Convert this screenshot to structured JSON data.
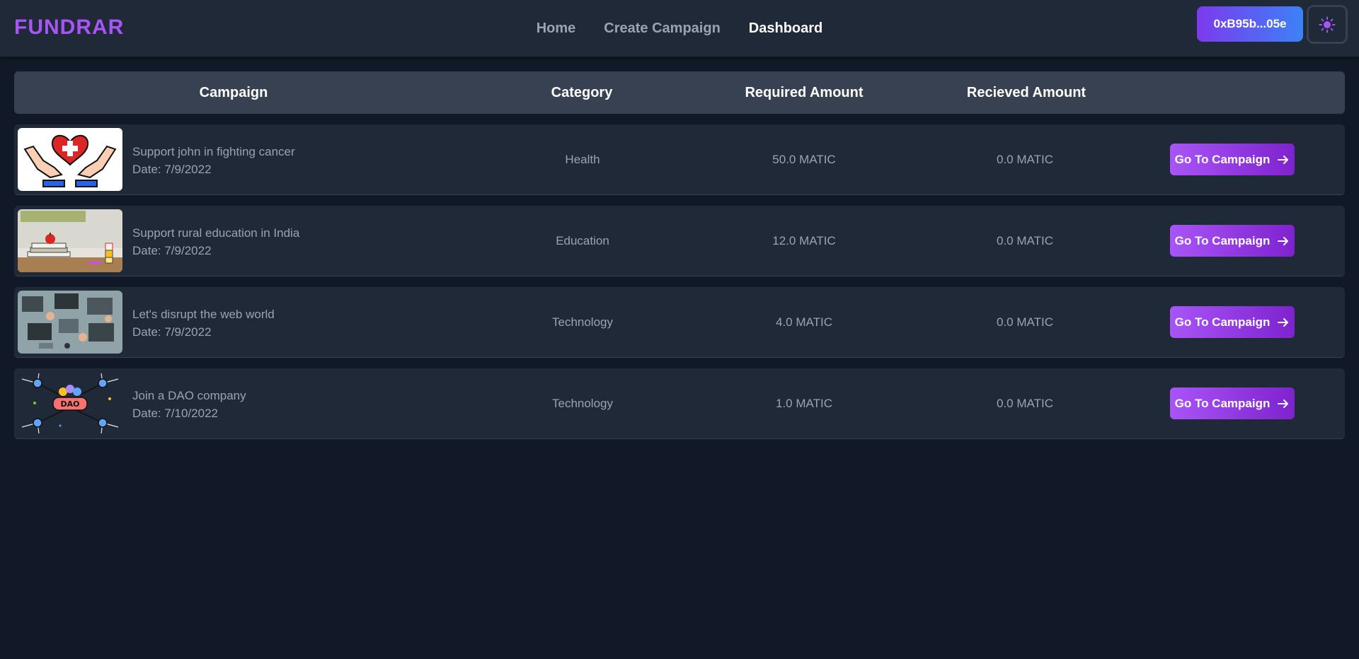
{
  "app": {
    "logo": "FUNDRAR"
  },
  "nav": {
    "links": [
      {
        "label": "Home"
      },
      {
        "label": "Create Campaign"
      },
      {
        "label": "Dashboard"
      }
    ]
  },
  "wallet": {
    "address": "0xB95b...05e"
  },
  "table": {
    "headers": [
      "Campaign",
      "Category",
      "Required Amount",
      "Recieved Amount"
    ],
    "rows": [
      {
        "title": "Support john in fighting cancer",
        "date": "Date: 7/9/2022",
        "category": "Health",
        "required": "50.0 MATIC",
        "received": "0.0 MATIC",
        "action": "Go To Campaign",
        "image": "heart-hands-image"
      },
      {
        "title": "Support rural education in India",
        "date": "Date: 7/9/2022",
        "category": "Education",
        "required": "12.0 MATIC",
        "received": "0.0 MATIC",
        "action": "Go To Campaign",
        "image": "books-apple-image"
      },
      {
        "title": "Let's disrupt the web world",
        "date": "Date: 7/9/2022",
        "category": "Technology",
        "required": "4.0 MATIC",
        "received": "0.0 MATIC",
        "action": "Go To Campaign",
        "image": "workspace-laptops-image"
      },
      {
        "title": "Join a DAO company",
        "date": "Date: 7/10/2022",
        "category": "Technology",
        "required": "1.0 MATIC",
        "received": "0.0 MATIC",
        "action": "Go To Campaign",
        "image": "dao-network-image"
      }
    ]
  },
  "colors": {
    "background": "#111827",
    "navbar": "#1f2937",
    "header": "#374151",
    "accent": "#a855f7",
    "wallet_gradient_start": "#7c3aed",
    "wallet_gradient_end": "#3b82f6"
  }
}
